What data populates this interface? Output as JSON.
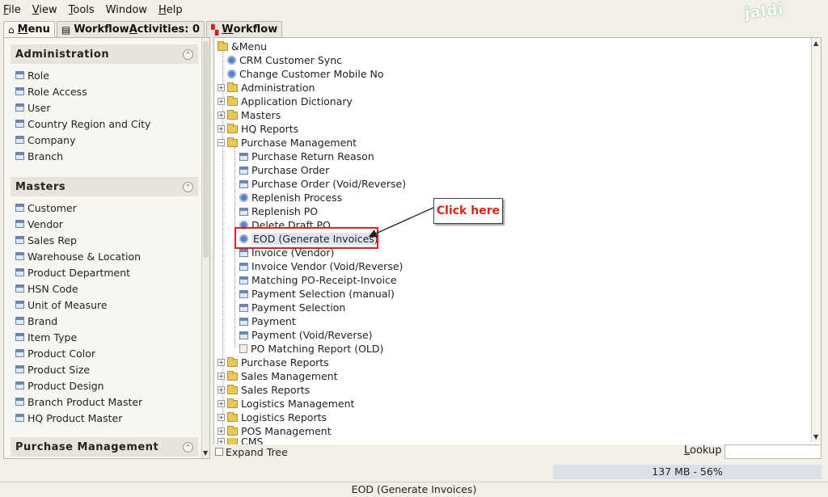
{
  "menubar": {
    "file_u": "F",
    "file_rest": "ile",
    "view_u": "V",
    "view_rest": "iew",
    "tools_u": "T",
    "tools_rest": "ools",
    "window": "Window",
    "help_u": "H",
    "help_rest": "elp"
  },
  "logo": "jaldi",
  "tabs": {
    "menu_u": "M",
    "menu_rest": "enu",
    "workflow_activities_pre": "Workflow ",
    "workflow_activities_u": "A",
    "workflow_activities_post": "ctivities: 0",
    "workflow_u": "W",
    "workflow_rest": "orkflow"
  },
  "sidebar": {
    "groups": [
      {
        "title": "Administration",
        "items": [
          "Role",
          "Role Access",
          "User",
          "Country Region and City",
          "Company",
          "Branch"
        ]
      },
      {
        "title": "Masters",
        "items": [
          "Customer",
          "Vendor",
          "Sales Rep",
          "Warehouse & Location",
          "Product Department",
          "HSN Code",
          "Unit of Measure",
          "Brand",
          "Item Type",
          "Product Color",
          "Product Size",
          "Product Design",
          "Branch Product Master",
          "HQ Product Master"
        ]
      },
      {
        "title": "Purchase Management",
        "items": []
      }
    ]
  },
  "tree": {
    "root": "&Menu",
    "nodes": [
      "CRM Customer Sync",
      "Change Customer Mobile No",
      "Administration",
      "Application Dictionary",
      "Masters",
      "HQ Reports",
      "Purchase Management",
      "Purchase Return Reason",
      "Purchase Order",
      "Purchase Order (Void/Reverse)",
      "Replenish Process",
      "Replenish PO",
      "Delete Draft PO",
      "EOD (Generate Invoices)",
      "Invoice (Vendor)",
      "Invoice Vendor (Void/Reverse)",
      "Matching PO-Receipt-Invoice",
      "Payment Selection (manual)",
      "Payment Selection",
      "Payment",
      "Payment (Void/Reverse)",
      "PO Matching Report (OLD)",
      "Purchase Reports",
      "Sales Management",
      "Sales Reports",
      "Logistics Management",
      "Logistics Reports",
      "POS Management",
      "CMS"
    ],
    "expand_tree": "Expand Tree",
    "lookup_u": "L",
    "lookup_rest": "ookup"
  },
  "callout": "Click here",
  "memory": "137 MB - 56%",
  "status": "EOD (Generate Invoices)",
  "colors": {
    "highlight": "#dd2222",
    "callout_text": "#dd1111"
  }
}
